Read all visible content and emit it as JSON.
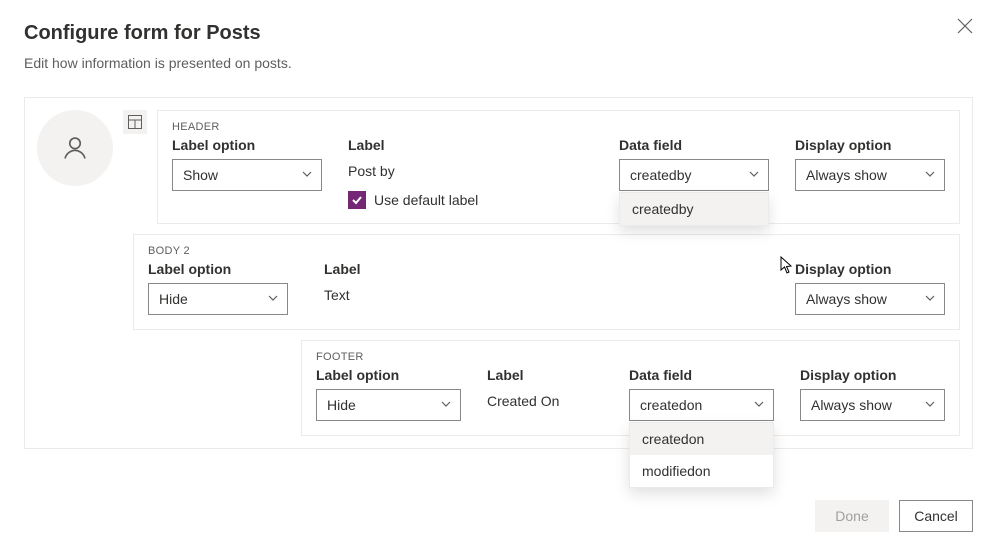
{
  "dialog": {
    "title": "Configure form for Posts",
    "subtitle": "Edit how information is presented on posts."
  },
  "header": {
    "section_name": "HEADER",
    "label_option_label": "Label option",
    "label_option_value": "Show",
    "label_label": "Label",
    "label_value": "Post by",
    "checkbox_label": "Use default label",
    "checkbox_checked": true,
    "data_field_label": "Data field",
    "data_field_value": "createdby",
    "data_field_options": [
      "createdby"
    ],
    "display_option_label": "Display option",
    "display_option_value": "Always show"
  },
  "body2": {
    "section_name": "BODY 2",
    "label_option_label": "Label option",
    "label_option_value": "Hide",
    "label_label": "Label",
    "label_value": "Text",
    "display_option_label": "Display option",
    "display_option_value": "Always show"
  },
  "footer": {
    "section_name": "FOOTER",
    "label_option_label": "Label option",
    "label_option_value": "Hide",
    "label_label": "Label",
    "label_value": "Created On",
    "data_field_label": "Data field",
    "data_field_value": "createdon",
    "data_field_options": [
      "createdon",
      "modifiedon"
    ],
    "display_option_label": "Display option",
    "display_option_value": "Always show"
  },
  "actions": {
    "primary": "Done",
    "secondary": "Cancel"
  }
}
